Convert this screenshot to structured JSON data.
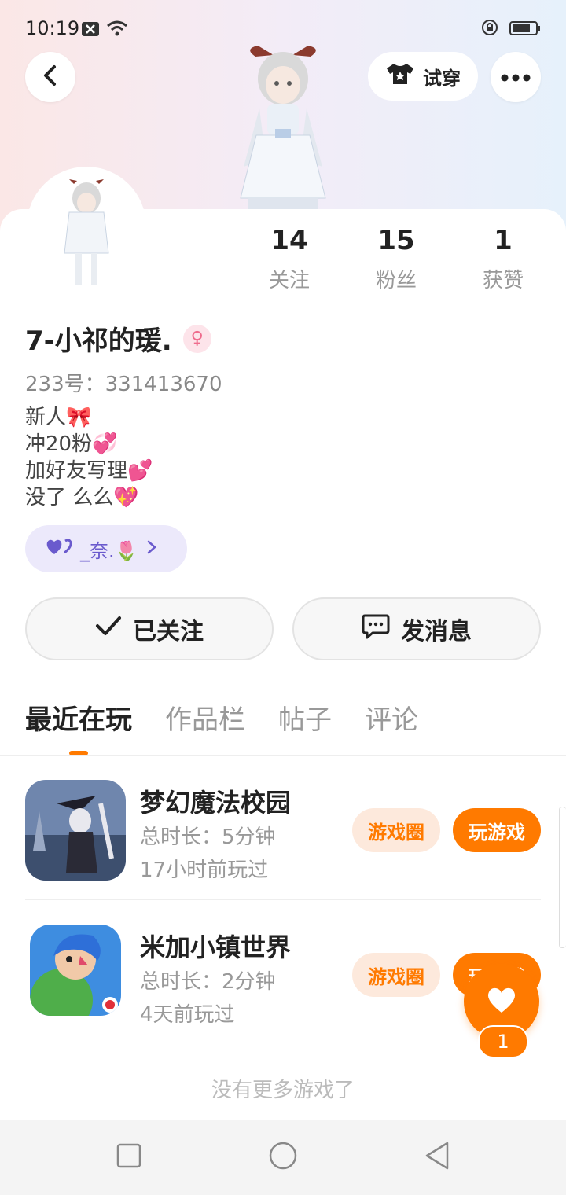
{
  "status": {
    "time": "10:19"
  },
  "header": {
    "tryon_label": "试穿"
  },
  "profile": {
    "name": "7-小祁的瑗.",
    "uid": "233号：331413670",
    "bio": [
      "新人🎀",
      "冲20粉💞",
      "加好友写理💕",
      "没了 么么💖"
    ],
    "tag": "_奈.🌷",
    "stats": [
      {
        "num": "14",
        "label": "关注"
      },
      {
        "num": "15",
        "label": "粉丝"
      },
      {
        "num": "1",
        "label": "获赞"
      }
    ]
  },
  "actions": {
    "followed": "已关注",
    "message": "发消息"
  },
  "tabs": [
    "最近在玩",
    "作品栏",
    "帖子",
    "评论"
  ],
  "games": [
    {
      "title": "梦幻魔法校园",
      "duration": "总时长：5分钟",
      "played": "17小时前玩过",
      "circle": "游戏圈",
      "play": "玩游戏"
    },
    {
      "title": "米加小镇世界",
      "duration": "总时长：2分钟",
      "played": "4天前玩过",
      "circle": "游戏圈",
      "play": "玩游戏"
    }
  ],
  "footer": {
    "no_more": "没有更多游戏了"
  },
  "fab": {
    "count": "1"
  },
  "colors": {
    "accent": "#ff7a00",
    "tag_bg": "#ece9fb"
  }
}
